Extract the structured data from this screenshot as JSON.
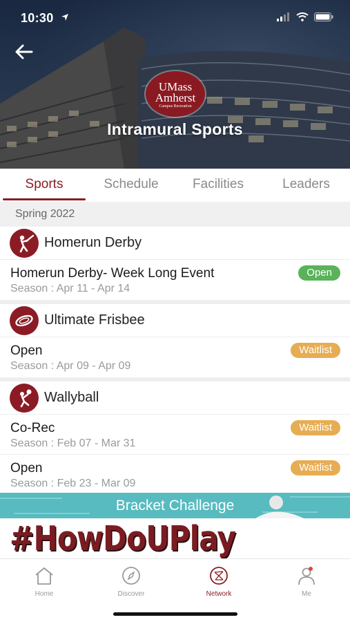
{
  "status_bar": {
    "time": "10:30",
    "icons": [
      "location-arrow-icon",
      "signal-icon",
      "wifi-icon",
      "battery-icon"
    ]
  },
  "header": {
    "logo": {
      "line1": "UMass",
      "line2": "Amherst",
      "line3": "Campus Recreation"
    },
    "title": "Intramural Sports",
    "back_icon": "back-arrow-icon"
  },
  "tabs": [
    {
      "label": "Sports",
      "active": true
    },
    {
      "label": "Schedule",
      "active": false
    },
    {
      "label": "Facilities",
      "active": false
    },
    {
      "label": "Leaders",
      "active": false
    }
  ],
  "season": "Spring 2022",
  "sports": [
    {
      "name": "Homerun Derby",
      "icon": "baseball-batter-icon",
      "entries": [
        {
          "name": "Homerun Derby- Week Long Event",
          "season": "Season : Apr 11 - Apr 14",
          "status": "Open"
        }
      ]
    },
    {
      "name": "Ultimate Frisbee",
      "icon": "frisbee-icon",
      "entries": [
        {
          "name": "Open",
          "season": "Season : Apr 09 - Apr 09",
          "status": "Waitlist"
        }
      ]
    },
    {
      "name": "Wallyball",
      "icon": "volleyball-player-icon",
      "entries": [
        {
          "name": "Co-Rec",
          "season": "Season : Feb 07 - Mar 31",
          "status": "Waitlist"
        },
        {
          "name": "Open",
          "season": "Season : Feb 23 - Mar 09",
          "status": "Waitlist"
        }
      ]
    }
  ],
  "banner": {
    "text": "Bracket Challenge"
  },
  "promo": {
    "text": "#HowDoUPlay"
  },
  "colors": {
    "accent": "#8b1c25",
    "open": "#5ab25a",
    "waitlist": "#e7ad52",
    "banner": "#57bbbf"
  },
  "bottom_nav": [
    {
      "label": "Home",
      "icon": "home-icon",
      "active": false
    },
    {
      "label": "Discover",
      "icon": "compass-icon",
      "active": false
    },
    {
      "label": "Network",
      "icon": "network-icon",
      "active": true
    },
    {
      "label": "Me",
      "icon": "person-icon",
      "active": false
    }
  ]
}
